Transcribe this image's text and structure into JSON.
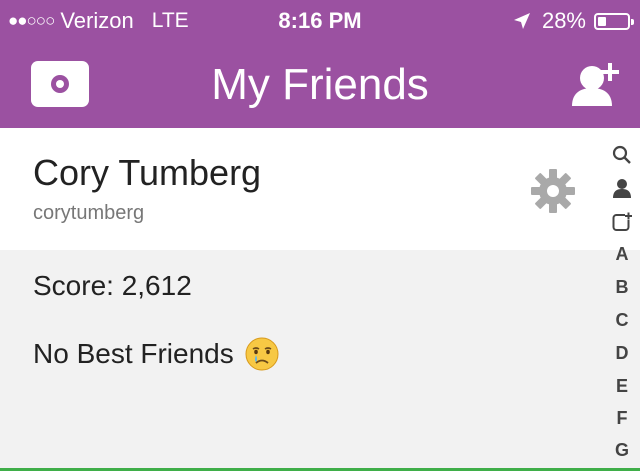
{
  "status_bar": {
    "signal": "●●○○○",
    "carrier": "Verizon",
    "network": "LTE",
    "time": "8:16 PM",
    "battery": "28%",
    "location_icon": "location-arrow-icon",
    "battery_icon": "battery-icon"
  },
  "nav": {
    "title": "My Friends",
    "left_icon": "camera-icon",
    "right_icon": "add-friend-icon"
  },
  "profile": {
    "display_name": "Cory Tumberg",
    "username": "corytumberg",
    "settings_icon": "gear-icon"
  },
  "stats": {
    "score": "Score: 2,612",
    "best_friends": "No Best Friends",
    "emoji_icon": "crying-face-icon"
  },
  "index": {
    "icons": [
      "search-icon",
      "person-icon",
      "add-box-icon"
    ],
    "letters": [
      "A",
      "B",
      "C",
      "D",
      "E",
      "F",
      "G"
    ]
  },
  "colors": {
    "brand": "#9b51a1",
    "card": "#ffffff",
    "background": "#f2f2f2",
    "gear": "#a9a9a9",
    "accent_line": "#3fae49"
  }
}
